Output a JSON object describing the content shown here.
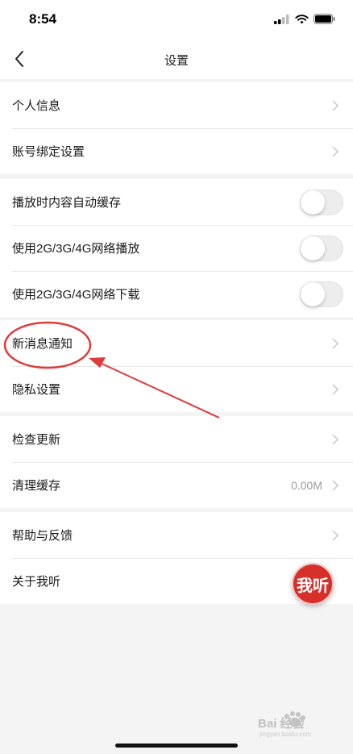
{
  "status_bar": {
    "time": "8:54",
    "icons": [
      "signal-icon",
      "wifi-icon",
      "battery-icon"
    ]
  },
  "nav": {
    "title": "设置",
    "back_icon": "chevron-left-icon"
  },
  "sections": [
    {
      "rows": [
        {
          "label": "个人信息",
          "type": "link"
        },
        {
          "label": "账号绑定设置",
          "type": "link"
        }
      ]
    },
    {
      "rows": [
        {
          "label": "播放时内容自动缓存",
          "type": "toggle",
          "on": false
        },
        {
          "label": "使用2G/3G/4G网络播放",
          "type": "toggle",
          "on": false
        },
        {
          "label": "使用2G/3G/4G网络下载",
          "type": "toggle",
          "on": false
        }
      ]
    },
    {
      "rows": [
        {
          "label": "新消息通知",
          "type": "link"
        },
        {
          "label": "隐私设置",
          "type": "link"
        }
      ]
    },
    {
      "rows": [
        {
          "label": "检查更新",
          "type": "link"
        },
        {
          "label": "清理缓存",
          "type": "value-link",
          "value": "0.00M"
        }
      ]
    },
    {
      "rows": [
        {
          "label": "帮助与反馈",
          "type": "link"
        },
        {
          "label": "关于我听",
          "type": "link"
        }
      ]
    }
  ],
  "fab": {
    "label": "我听",
    "color": "#d7302b"
  },
  "annotation": {
    "color": "#e03a3a",
    "target": "新消息通知"
  },
  "watermark": {
    "text": "Bai 经验",
    "subtext": "jingyan.baidu.com"
  },
  "colors": {
    "background": "#f4f4f4",
    "row_background": "#ffffff",
    "divider": "#e9e9e9",
    "secondary_text": "#9a9a9a"
  }
}
